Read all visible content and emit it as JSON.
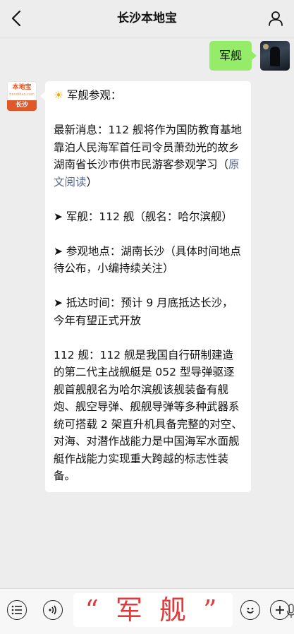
{
  "header": {
    "title": "长沙本地宝"
  },
  "icons": {
    "back": "back-chevron-icon",
    "profile": "person-icon",
    "menu": "menu-list-icon",
    "voice": "voice-icon",
    "mic": "mic-icon",
    "emoji": "emoji-icon",
    "add": "plus-icon"
  },
  "chat": {
    "user_message": "军舰",
    "bot_avatar": {
      "logo_top": "本地宝",
      "logo_sub": "bendibao.com",
      "logo_bottom": "长沙"
    },
    "bot_message": {
      "heading_emoji": "☀",
      "heading": "军舰参观：",
      "news": "最新消息：112 舰将作为国防教育基地靠泊人民海军首任司令员萧劲光的故乡湖南省长沙市供市民游客参观学习（",
      "news_link": "原文阅读",
      "news_end": "）",
      "ship": "➤ 军舰：112 舰（舰名：哈尔滨舰）",
      "location": "➤ 参观地点：湖南长沙（具体时间地点待公布，小编持续关注）",
      "arrival": "➤ 抵达时间：预计 9 月底抵达长沙，今年有望正式开放",
      "desc": "112 舰：112 舰是我国自行研制建造的第二代主战舰艇是 052 型导弹驱逐舰首舰舰名为哈尔滨舰该舰装备有舰炮、舰空导弹、舰舰导弹等多种武器系统可搭载 2 架直升机具备完整的对空、对海、对潜作战能力是中国海军水面舰艇作战能力实现重大跨越的标志性装备。"
    }
  },
  "input": {
    "value": "“ 军 舰 ”"
  },
  "colors": {
    "user_bubble": "#95ec69",
    "link": "#576b95",
    "input_text": "#e23a3a",
    "brand": "#e0572a"
  }
}
